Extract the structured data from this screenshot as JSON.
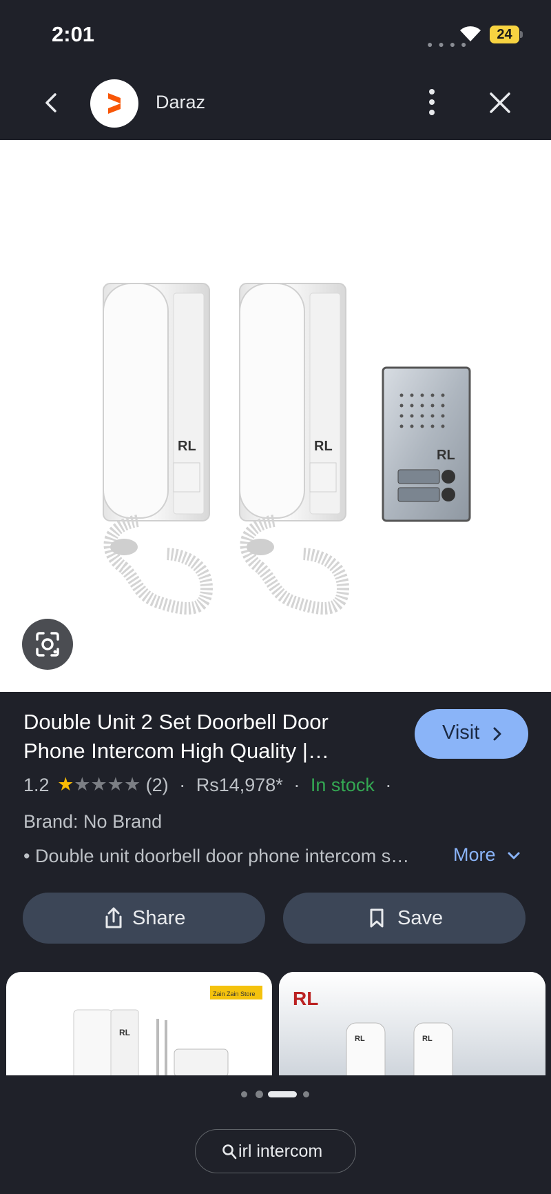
{
  "status_bar": {
    "time": "2:01",
    "battery_level": "24",
    "battery_color": "#f7d341"
  },
  "header": {
    "site_name": "Daraz",
    "logo_color": "#f85606"
  },
  "product": {
    "image_brand_text": "RL",
    "title": "Double Unit 2 Set Doorbell Door Phone Intercom High Quality |…",
    "visit_label": "Visit",
    "rating": "1.2",
    "rating_value": 1.2,
    "rating_max": 5,
    "review_count": "(2)",
    "price": "Rs14,978*",
    "stock": "In stock",
    "separator": "·",
    "brand": "Brand: No Brand",
    "description": "• Double unit doorbell door phone intercom s…",
    "more_label": "More"
  },
  "actions": {
    "share_label": "Share",
    "save_label": "Save"
  },
  "thumbnails": [
    {
      "badge": "Zain Zain Store",
      "brand_text": "RL"
    },
    {
      "brand_text": "RL"
    }
  ],
  "pager": {
    "count": 4,
    "active_index": 2
  },
  "query": {
    "text": "irl intercom"
  },
  "colors": {
    "accent": "#8ab4f8",
    "in_stock": "#34a853",
    "star": "#fbbc04",
    "background": "#1f2129"
  }
}
